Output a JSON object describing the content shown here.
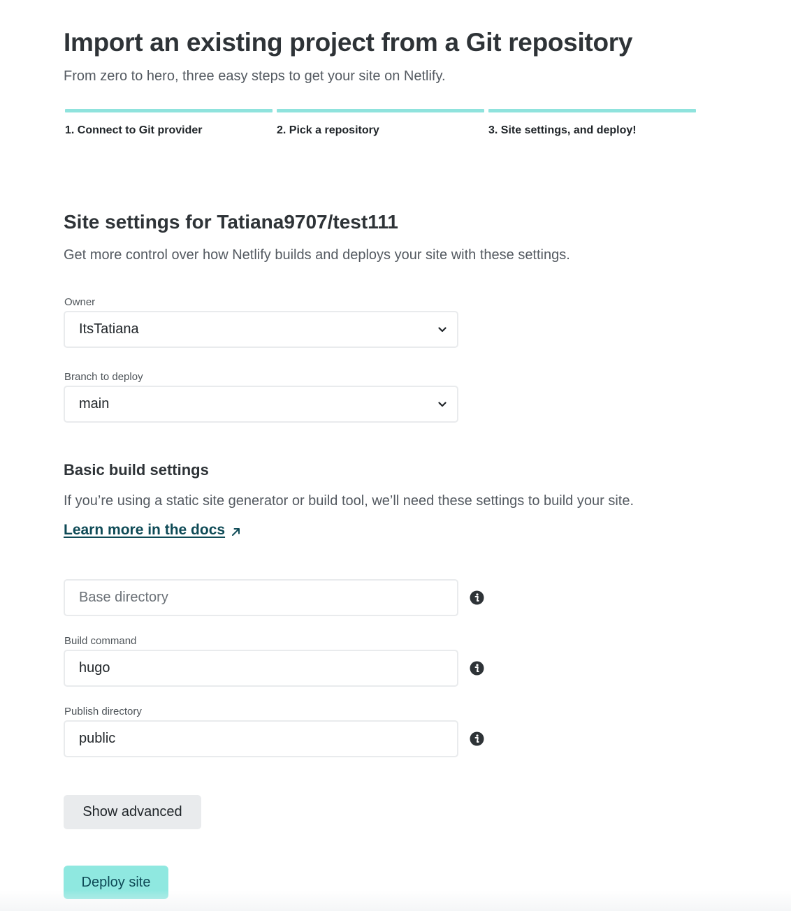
{
  "header": {
    "title": "Import an existing project from a Git repository",
    "subtitle": "From zero to hero, three easy steps to get your site on Netlify."
  },
  "steps": [
    {
      "label": "1. Connect to Git provider"
    },
    {
      "label": "2. Pick a repository"
    },
    {
      "label": "3. Site settings, and deploy!"
    }
  ],
  "colors": {
    "accent": "#8fe3dd",
    "link": "#0e4a56",
    "deploy_button": "#8fe8e0"
  },
  "site_settings": {
    "heading": "Site settings for Tatiana9707/test111",
    "description": "Get more control over how Netlify builds and deploys your site with these settings.",
    "owner": {
      "label": "Owner",
      "value": "ItsTatiana",
      "icon": "chevron-down-icon"
    },
    "branch": {
      "label": "Branch to deploy",
      "value": "main",
      "icon": "chevron-down-icon"
    }
  },
  "build_settings": {
    "heading": "Basic build settings",
    "description": "If you’re using a static site generator or build tool, we’ll need these settings to build your site.",
    "docs_link": "Learn more in the docs",
    "base_directory": {
      "placeholder": "Base directory",
      "value": ""
    },
    "build_command": {
      "label": "Build command",
      "value": "hugo"
    },
    "publish_directory": {
      "label": "Publish directory",
      "value": "public"
    },
    "info_icon": "info-icon"
  },
  "actions": {
    "show_advanced": "Show advanced",
    "deploy": "Deploy site"
  }
}
